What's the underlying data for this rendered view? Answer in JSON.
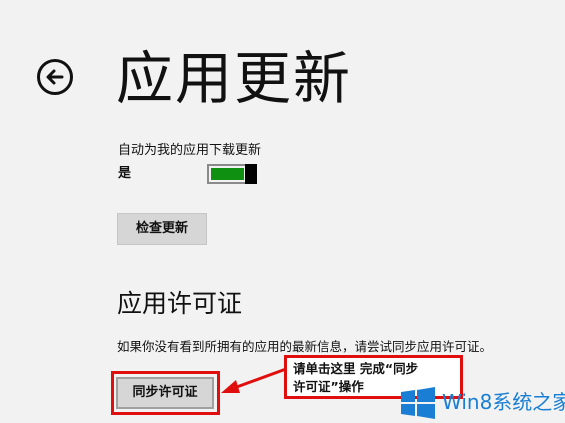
{
  "header": {
    "title": "应用更新",
    "back_icon": "back-arrow-icon"
  },
  "auto_update": {
    "label": "自动为我的应用下载更新",
    "state_label": "是",
    "enabled": true,
    "toggle_color": "#109010"
  },
  "check_button": {
    "label": "检查更新"
  },
  "license": {
    "title": "应用许可证",
    "info": "如果你没有看到所拥有的应用的最新信息，请尝试同步应用许可证。",
    "sync_button": "同步许可证"
  },
  "annotation": {
    "line1": "请单击这里 完成“同步",
    "line2": "许可证”操作",
    "color": "#e10e0e"
  },
  "watermark": {
    "text": "Win8系统之家",
    "logo_icon": "windows-logo-icon",
    "color": "#1a7fd4"
  }
}
